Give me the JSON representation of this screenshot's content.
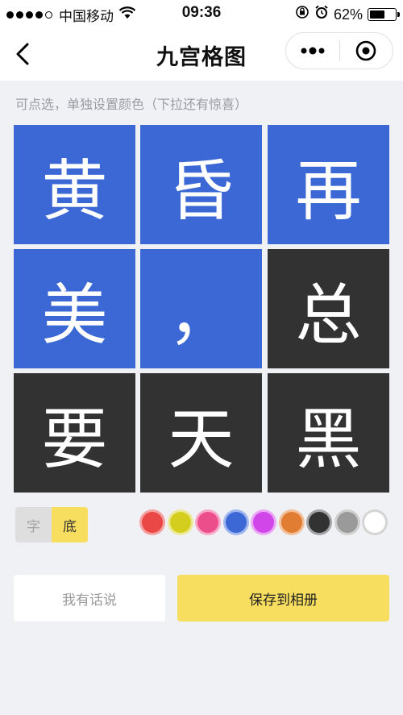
{
  "status_bar": {
    "carrier": "中国移动",
    "time": "09:36",
    "battery_percent": "62%",
    "battery_level": 0.62
  },
  "nav": {
    "title": "九宫格图",
    "back_icon": "chevron-left-icon",
    "more_icon": "more-dots-icon",
    "target_icon": "target-circle-icon"
  },
  "hint": "可点选，单独设置颜色（下拉还有惊喜）",
  "colors": {
    "blue": "#3b68d4",
    "dark": "#323232",
    "accent_yellow": "#f7de5e"
  },
  "grid": [
    {
      "char": "黄",
      "bg": "#3b68d4"
    },
    {
      "char": "昏",
      "bg": "#3b68d4"
    },
    {
      "char": "再",
      "bg": "#3b68d4"
    },
    {
      "char": "美",
      "bg": "#3b68d4"
    },
    {
      "char": "，",
      "bg": "#3b68d4"
    },
    {
      "char": "总",
      "bg": "#323232"
    },
    {
      "char": "要",
      "bg": "#323232"
    },
    {
      "char": "天",
      "bg": "#323232"
    },
    {
      "char": "黑",
      "bg": "#323232"
    }
  ],
  "mode_toggle": {
    "text_label": "字",
    "bg_label": "底",
    "selected": "底"
  },
  "palette": [
    {
      "fill": "#ea4747",
      "ring": "#f5a0a0"
    },
    {
      "fill": "#d4cf1e",
      "ring": "#ecea98"
    },
    {
      "fill": "#ec4d8b",
      "ring": "#f7a8c7"
    },
    {
      "fill": "#3b68d4",
      "ring": "#a0b6ee"
    },
    {
      "fill": "#d046e8",
      "ring": "#eba6f6"
    },
    {
      "fill": "#e07d32",
      "ring": "#f3bf98"
    },
    {
      "fill": "#323232",
      "ring": "#a3a3a3"
    },
    {
      "fill": "#9a9a9a",
      "ring": "#cfcfcf"
    },
    {
      "fill": "#ffffff",
      "ring": "#d4d4d4"
    }
  ],
  "buttons": {
    "say": "我有话说",
    "save": "保存到相册"
  }
}
